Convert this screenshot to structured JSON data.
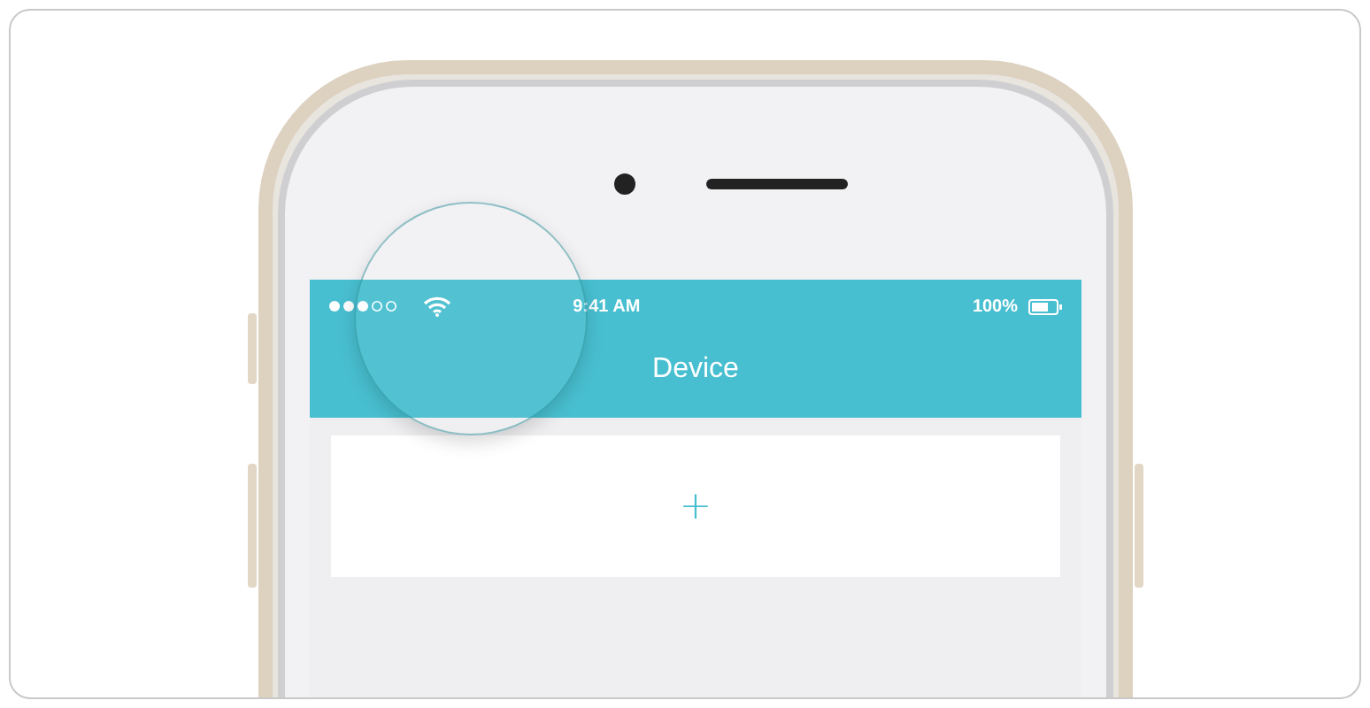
{
  "status_bar": {
    "time": "9:41 AM",
    "battery": "100%"
  },
  "header": {
    "title": "Device"
  },
  "add_card": {
    "label": "+"
  }
}
